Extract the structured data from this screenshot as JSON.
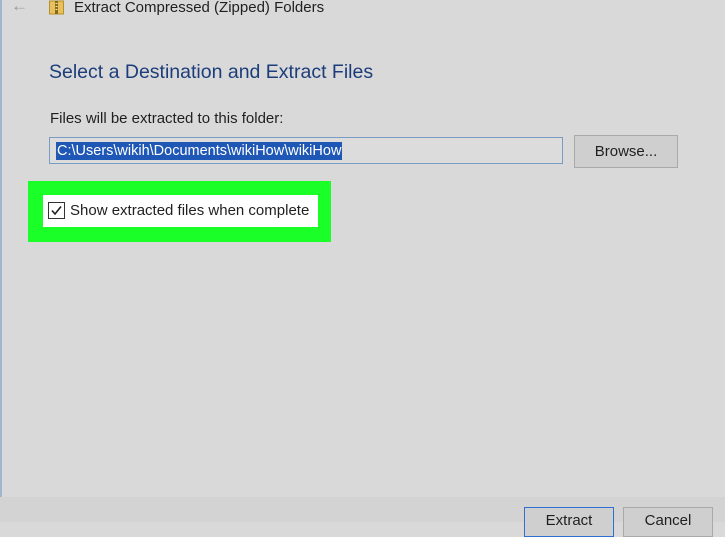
{
  "window": {
    "title": "Extract Compressed (Zipped) Folders",
    "back_icon": "back-arrow-icon",
    "folder_icon": "zipped-folder-icon"
  },
  "dialog": {
    "heading": "Select a Destination and Extract Files",
    "path_label": "Files will be extracted to this folder:",
    "path_value": "C:\\Users\\wikih\\Documents\\wikiHow\\wikiHow",
    "browse_label": "Browse...",
    "show_files_label": "Show extracted files when complete",
    "show_files_checked": true
  },
  "footer": {
    "extract_label": "Extract",
    "cancel_label": "Cancel"
  },
  "colors": {
    "background": "#d9d9d9",
    "heading": "#1c3d7a",
    "selection": "#1f57b6",
    "highlight": "#19ff27",
    "focus_border": "#2f6fd0"
  }
}
